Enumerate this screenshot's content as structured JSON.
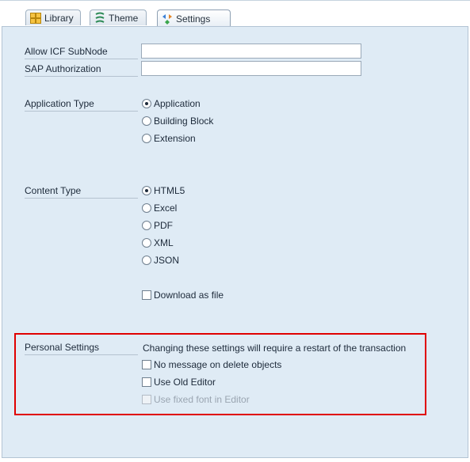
{
  "tabs": [
    {
      "label": "Library",
      "icon": "library-icon",
      "active": false
    },
    {
      "label": "Theme",
      "icon": "theme-icon",
      "active": false
    },
    {
      "label": "Settings",
      "icon": "settings-icon",
      "active": true
    }
  ],
  "fields": {
    "icf_subnode": {
      "label": "Allow ICF SubNode",
      "value": ""
    },
    "sap_auth": {
      "label": "SAP Authorization",
      "value": ""
    }
  },
  "app_type": {
    "label": "Application Type",
    "options": [
      "Application",
      "Building Block",
      "Extension"
    ],
    "selected": "Application"
  },
  "content_type": {
    "label": "Content Type",
    "options": [
      "HTML5",
      "Excel",
      "PDF",
      "XML",
      "JSON"
    ],
    "selected": "HTML5",
    "download_label": "Download as file"
  },
  "personal": {
    "label": "Personal Settings",
    "note": "Changing these settings will require a restart of the transaction",
    "no_message_label": "No message on delete objects",
    "old_editor_label": "Use Old Editor",
    "fixed_font_label": "Use fixed font in Editor"
  },
  "colors": {
    "highlight": "#e00000",
    "panel": "#dfebf5"
  }
}
